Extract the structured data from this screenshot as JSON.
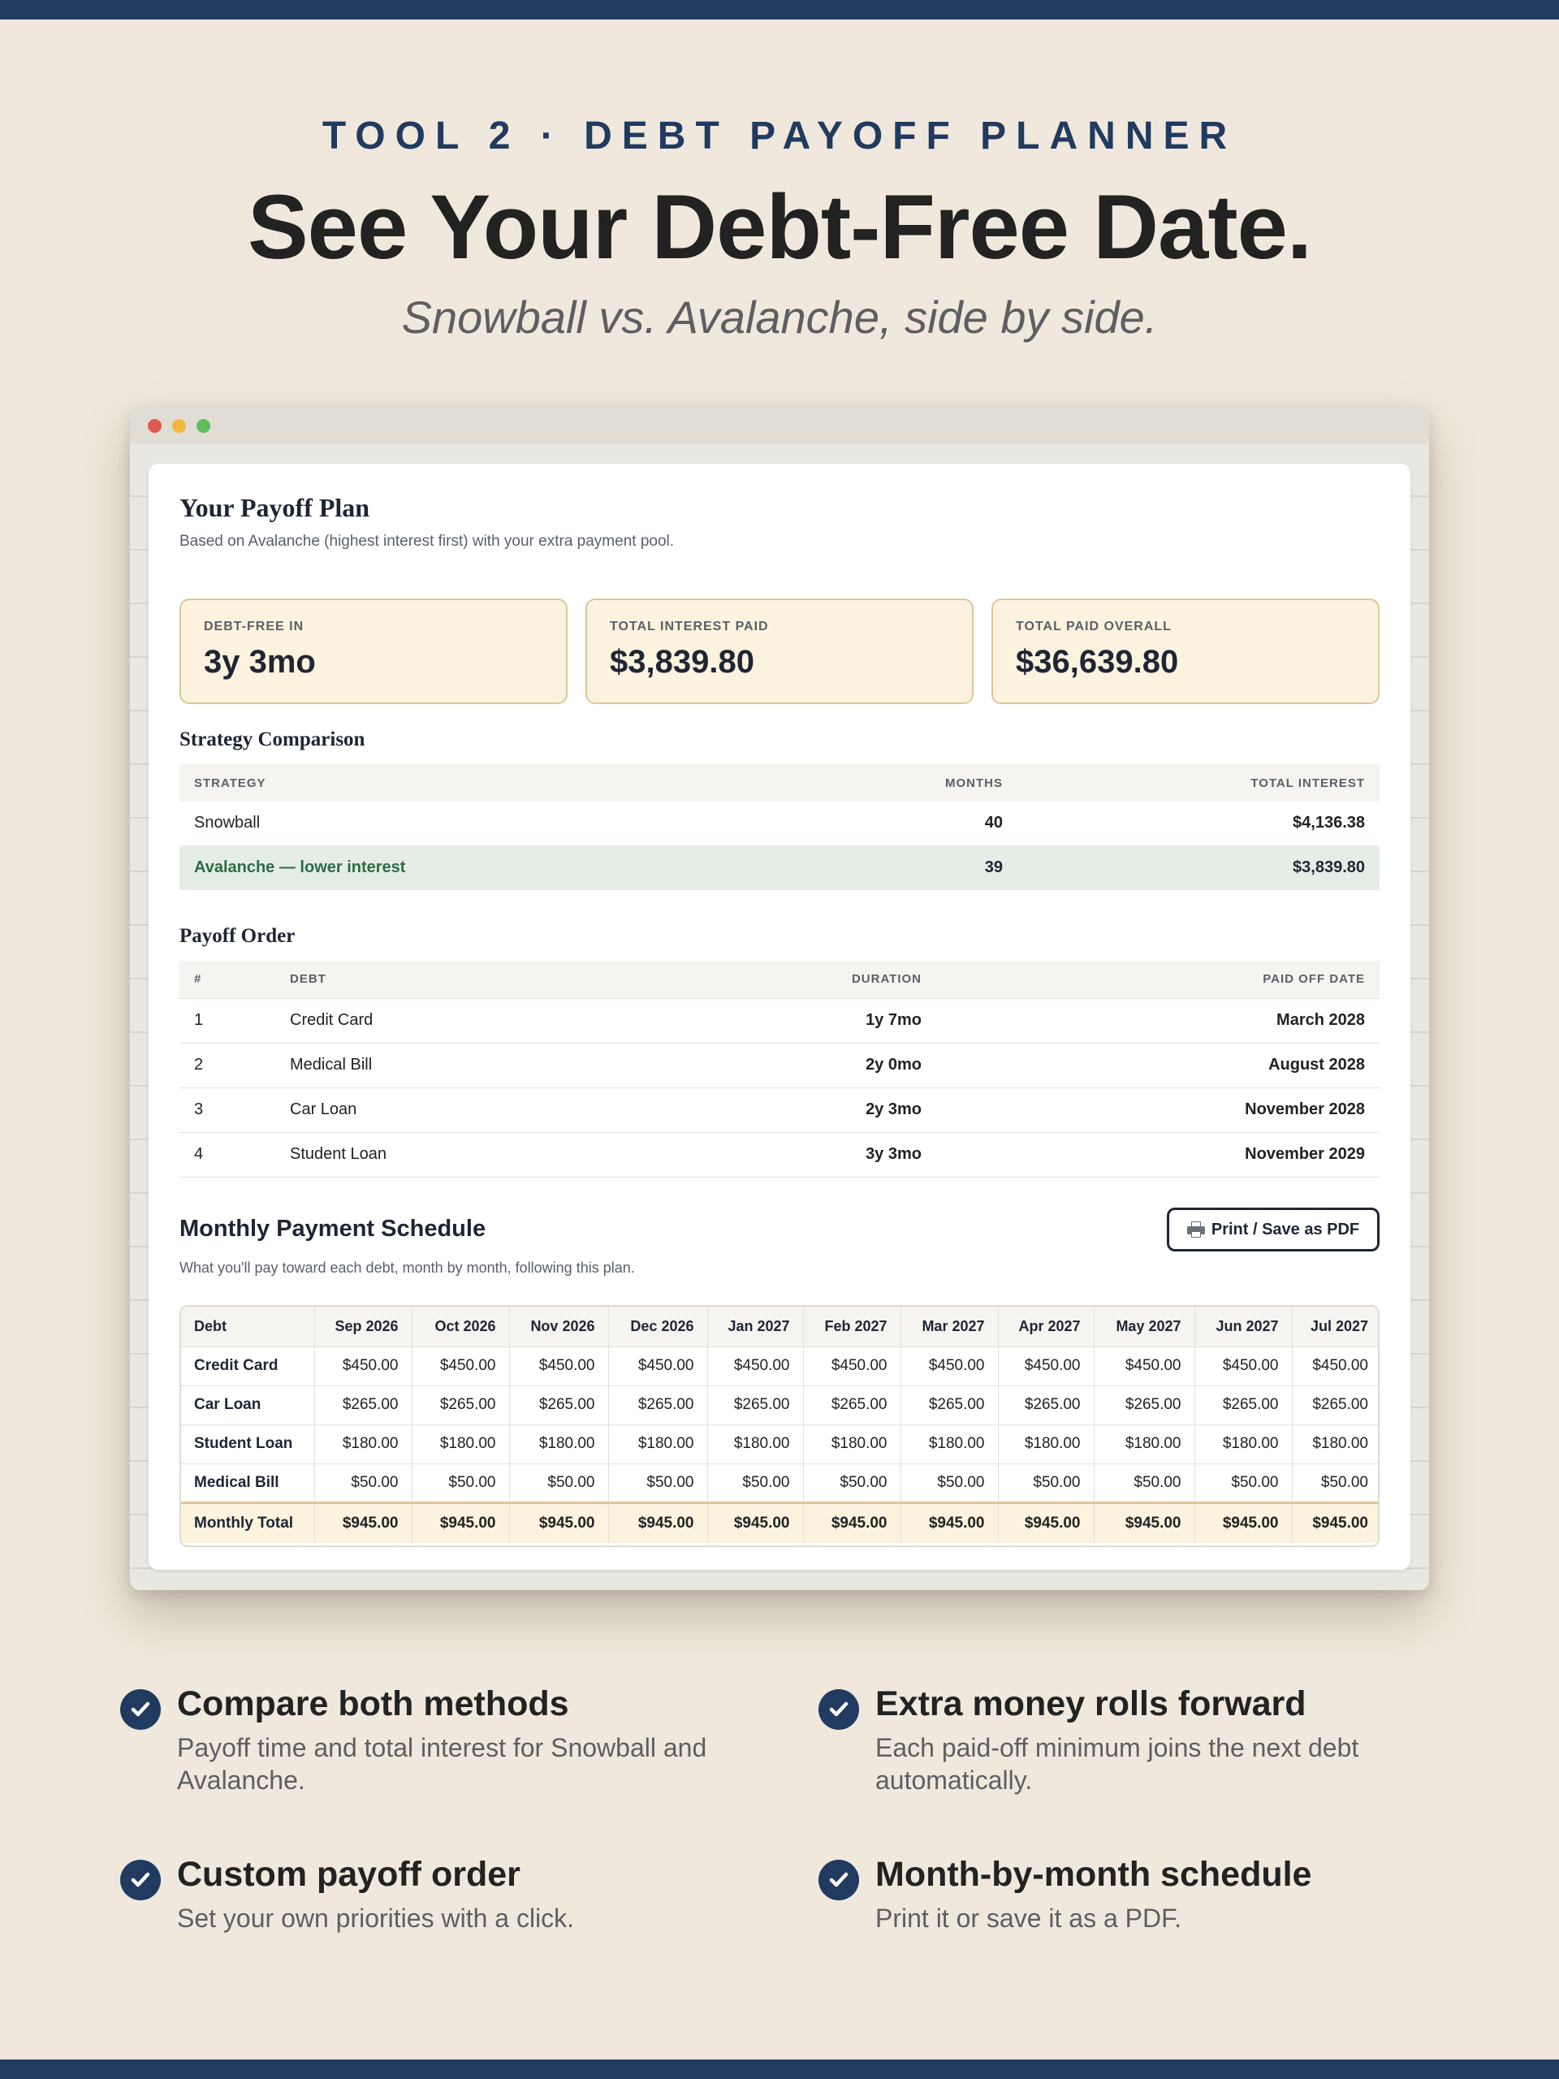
{
  "hero": {
    "eyebrow": "TOOL 2 · DEBT PAYOFF PLANNER",
    "headline": "See Your Debt-Free Date.",
    "subhead": "Snowball vs. Avalanche, side by side."
  },
  "plan": {
    "title": "Your Payoff Plan",
    "description": "Based on Avalanche (highest interest first) with your extra payment pool."
  },
  "stats": [
    {
      "label": "DEBT-FREE IN",
      "value": "3y 3mo"
    },
    {
      "label": "TOTAL INTEREST PAID",
      "value": "$3,839.80"
    },
    {
      "label": "TOTAL PAID OVERALL",
      "value": "$36,639.80"
    }
  ],
  "comparison": {
    "title": "Strategy Comparison",
    "headers": [
      "STRATEGY",
      "MONTHS",
      "TOTAL INTEREST"
    ],
    "rows": [
      {
        "strategy": "Snowball",
        "months": "40",
        "interest": "$4,136.38"
      },
      {
        "strategy": "Avalanche — lower interest",
        "months": "39",
        "interest": "$3,839.80"
      }
    ]
  },
  "order": {
    "title": "Payoff Order",
    "headers": [
      "#",
      "DEBT",
      "DURATION",
      "PAID OFF DATE"
    ],
    "rows": [
      {
        "num": "1",
        "debt": "Credit Card",
        "duration": "1y 7mo",
        "date": "March 2028"
      },
      {
        "num": "2",
        "debt": "Medical Bill",
        "duration": "2y 0mo",
        "date": "August 2028"
      },
      {
        "num": "3",
        "debt": "Car Loan",
        "duration": "2y 3mo",
        "date": "November 2028"
      },
      {
        "num": "4",
        "debt": "Student Loan",
        "duration": "3y 3mo",
        "date": "November 2029"
      }
    ]
  },
  "schedule": {
    "title": "Monthly Payment Schedule",
    "description": "What you'll pay toward each debt, month by month, following this plan.",
    "print_label": "Print / Save as PDF",
    "print_icon": "printer-icon",
    "headers": [
      "Debt",
      "Sep 2026",
      "Oct 2026",
      "Nov 2026",
      "Dec 2026",
      "Jan 2027",
      "Feb 2027",
      "Mar 2027",
      "Apr 2027",
      "May 2027",
      "Jun 2027",
      "Jul 2027"
    ],
    "rows": [
      {
        "name": "Credit Card",
        "values": [
          "$450.00",
          "$450.00",
          "$450.00",
          "$450.00",
          "$450.00",
          "$450.00",
          "$450.00",
          "$450.00",
          "$450.00",
          "$450.00",
          "$450.00"
        ]
      },
      {
        "name": "Car Loan",
        "values": [
          "$265.00",
          "$265.00",
          "$265.00",
          "$265.00",
          "$265.00",
          "$265.00",
          "$265.00",
          "$265.00",
          "$265.00",
          "$265.00",
          "$265.00"
        ]
      },
      {
        "name": "Student Loan",
        "values": [
          "$180.00",
          "$180.00",
          "$180.00",
          "$180.00",
          "$180.00",
          "$180.00",
          "$180.00",
          "$180.00",
          "$180.00",
          "$180.00",
          "$180.00"
        ]
      },
      {
        "name": "Medical Bill",
        "values": [
          "$50.00",
          "$50.00",
          "$50.00",
          "$50.00",
          "$50.00",
          "$50.00",
          "$50.00",
          "$50.00",
          "$50.00",
          "$50.00",
          "$50.00"
        ]
      }
    ],
    "total": {
      "name": "Monthly Total",
      "values": [
        "$945.00",
        "$945.00",
        "$945.00",
        "$945.00",
        "$945.00",
        "$945.00",
        "$945.00",
        "$945.00",
        "$945.00",
        "$945.00",
        "$945.00"
      ]
    }
  },
  "features": [
    {
      "title": "Compare both methods",
      "desc": "Payoff time and total interest for Snowball and Avalanche."
    },
    {
      "title": "Extra money rolls forward",
      "desc": "Each paid-off minimum joins the next debt automatically."
    },
    {
      "title": "Custom payoff order",
      "desc": "Set your own priorities with a click."
    },
    {
      "title": "Month-by-month schedule",
      "desc": "Print it or save it as a PDF."
    }
  ],
  "colors": {
    "navy": "#213a60",
    "background": "#f0e8dc",
    "highlight": "#fbf3de",
    "avalanche_green": "#2e6b45"
  }
}
